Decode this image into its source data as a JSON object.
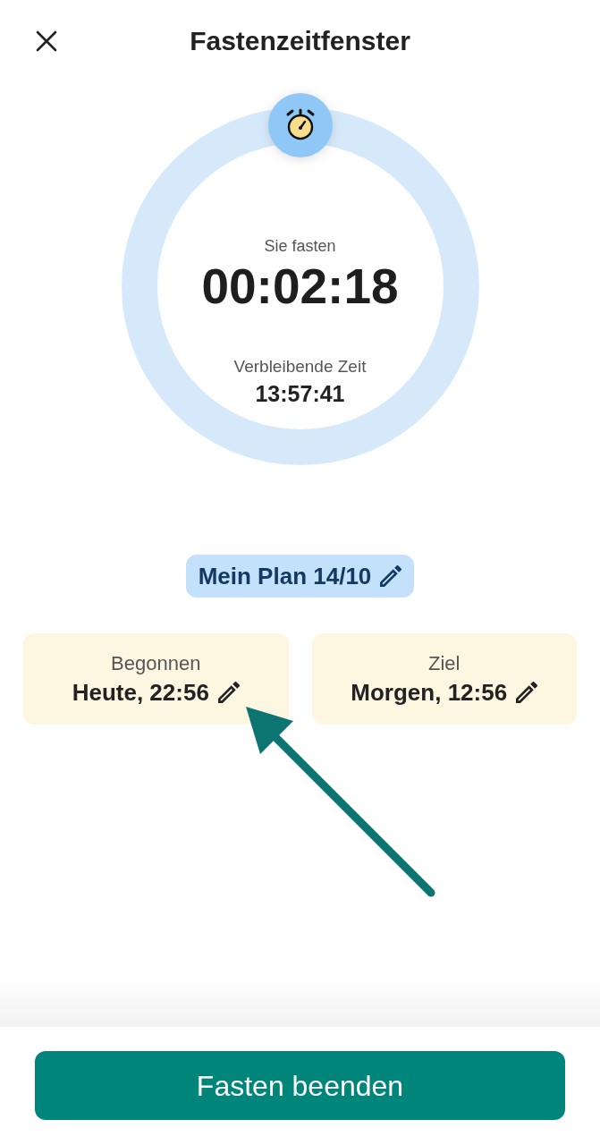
{
  "header": {
    "title": "Fastenzeitfenster"
  },
  "timer": {
    "status_label": "Sie fasten",
    "elapsed": "00:02:18",
    "remaining_label": "Verbleibende Zeit",
    "remaining": "13:57:41"
  },
  "plan": {
    "label": "Mein Plan 14/10"
  },
  "time_cards": [
    {
      "label": "Begonnen",
      "value": "Heute, 22:56"
    },
    {
      "label": "Ziel",
      "value": "Morgen, 12:56"
    }
  ],
  "primary_button": {
    "label": "Fasten beenden"
  }
}
